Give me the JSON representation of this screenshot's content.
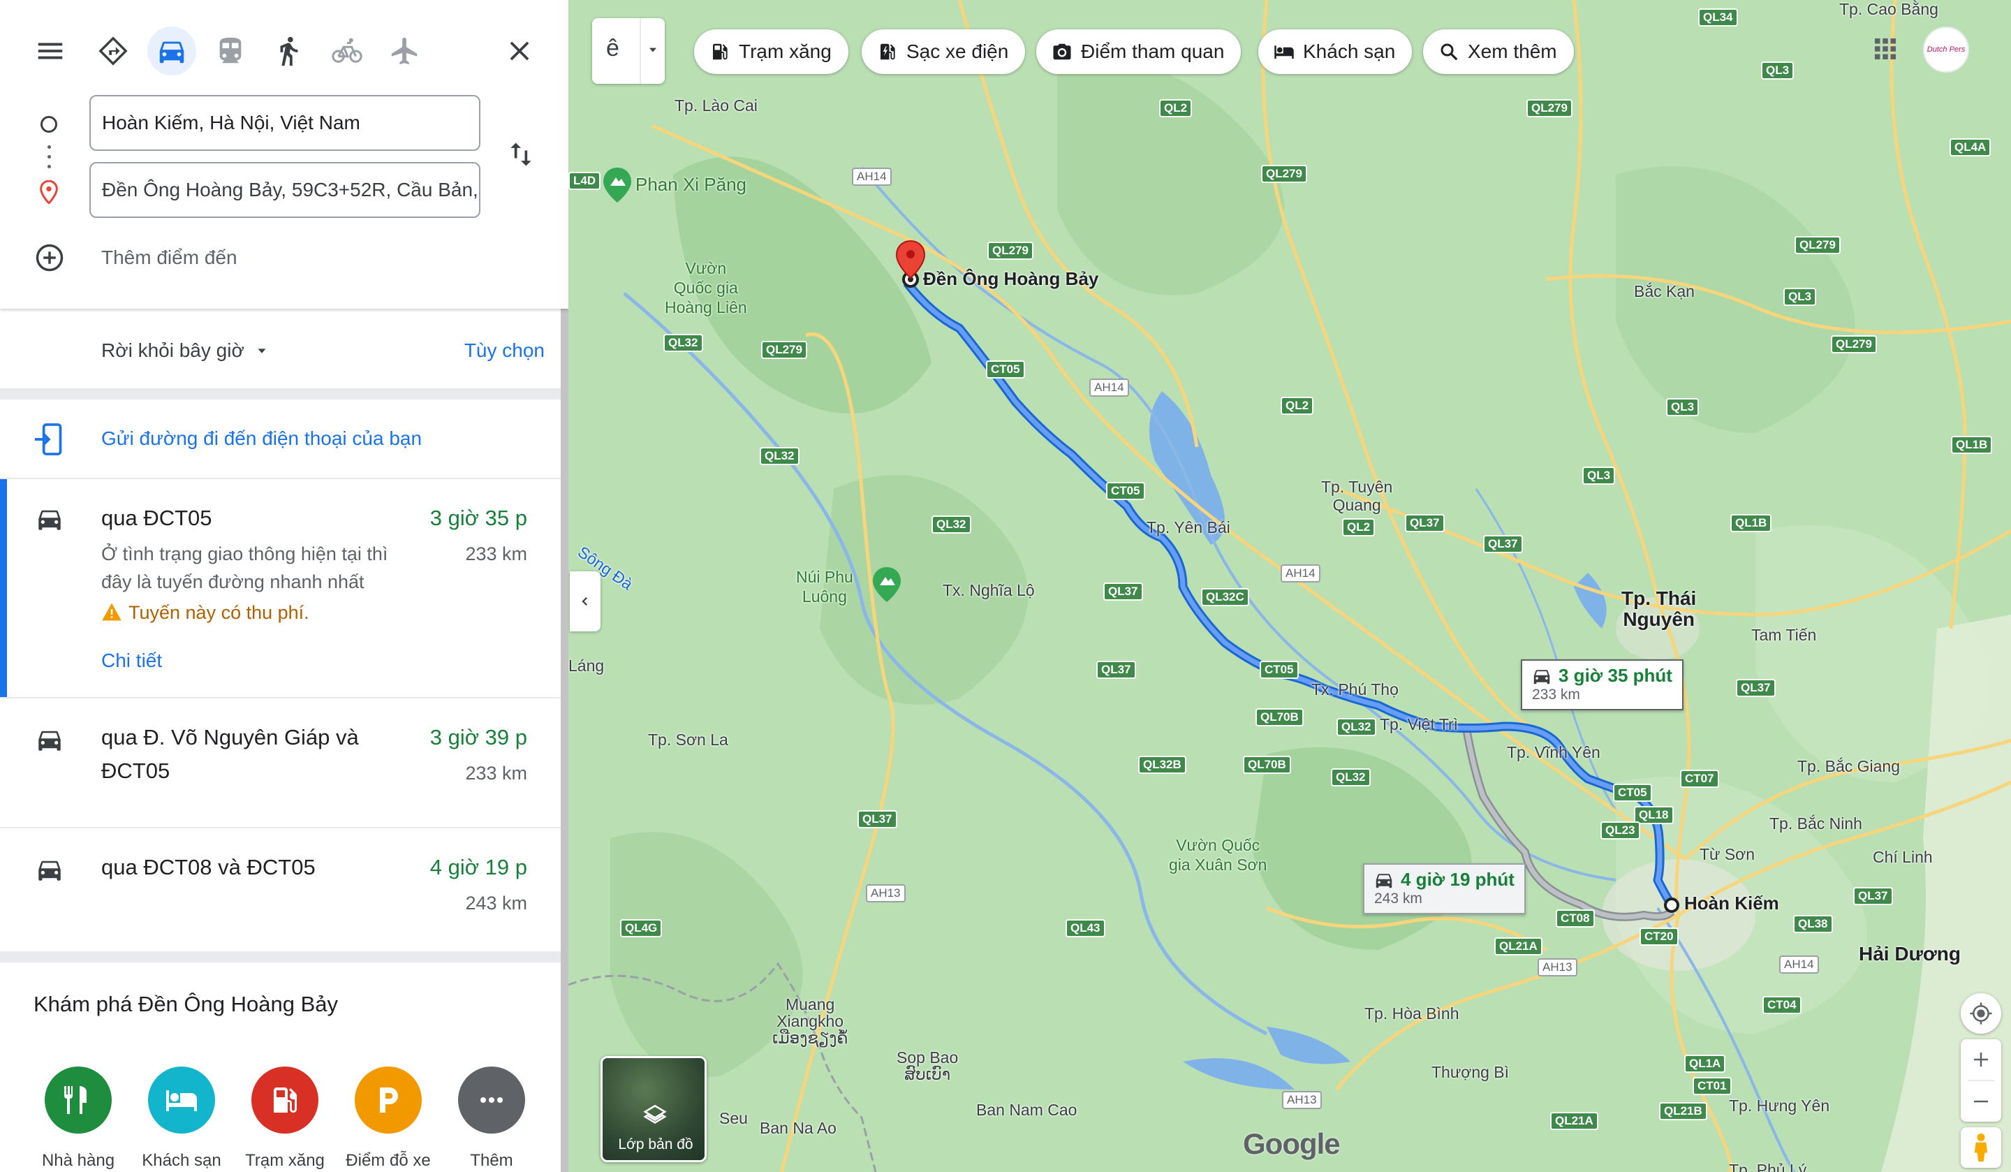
{
  "directions": {
    "origin_value": "Hoàn Kiếm, Hà Nội, Việt Nam",
    "destination_value": "Đền Ông Hoàng Bảy, 59C3+52R, Cầu Bản, ...",
    "add_destination": "Thêm điểm đến",
    "depart_label": "Rời khỏi bây giờ",
    "options_label": "Tùy chọn",
    "send_to_phone": "Gửi đường đi đến điện thoại của bạn"
  },
  "routes": [
    {
      "title": "qua ĐCT05",
      "time": "3 giờ 35 p",
      "distance": "233 km",
      "desc_line1": "Ở tình trạng giao thông hiện tại thì",
      "desc_line2": "đây là tuyến đường nhanh nhất",
      "warning": "Tuyến này có thu phí.",
      "details": "Chi tiết"
    },
    {
      "title_line1": "qua Đ. Võ Nguyên Giáp và",
      "title_line2": "ĐCT05",
      "time": "3 giờ 39 p",
      "distance": "233 km"
    },
    {
      "title": "qua ĐCT08 và ĐCT05",
      "time": "4 giờ 19 p",
      "distance": "243 km"
    }
  ],
  "explore": {
    "title": "Khám phá Đền Ông Hoàng Bảy",
    "categories": [
      {
        "label": "Nhà hàng",
        "icon": "restaurant-icon",
        "color": "#1e8e3e"
      },
      {
        "label": "Khách sạn",
        "icon": "hotel-icon",
        "color": "#12b5cb"
      },
      {
        "label": "Trạm xăng",
        "icon": "gas-station-icon",
        "color": "#d93025"
      },
      {
        "label": "Điểm đỗ xe",
        "icon": "parking-icon",
        "color": "#f29900"
      },
      {
        "label": "Thêm",
        "icon": "more-icon",
        "color": "#5f6368"
      }
    ]
  },
  "map": {
    "search_glyph": "ê",
    "chips": [
      "Trạm xăng",
      "Sạc xe điện",
      "Điểm tham quan",
      "Khách sạn",
      "Xem thêm"
    ],
    "avatar_text": "Dutch Pers",
    "layers_label": "Lớp bản đồ",
    "google_logo": "Google",
    "destination_label": "Đền Ông Hoàng Bảy",
    "origin_label": "Hoàn Kiếm",
    "route_primary": {
      "time": "3 giờ 35 phút",
      "distance": "233 km"
    },
    "route_alt": {
      "time": "4 giờ 19 phút",
      "distance": "243 km"
    },
    "places": {
      "lao_cai": "Tp. Lào Cai",
      "phan_xi_pang": "Phan Xi Păng",
      "hoang_lien": [
        "Vườn",
        "Quốc gia",
        "Hoàng Liên"
      ],
      "song_da": "Sông Đà",
      "nui_phu_luong": [
        "Núi Phu",
        "Luông"
      ],
      "nghia_lo": "Tx. Nghĩa Lộ",
      "yen_bai": "Tp. Yên Bái",
      "tuyen_quang": [
        "Tp. Tuyên",
        "Quang"
      ],
      "bac_kan": "Bắc Kạn",
      "thai_nguyen": [
        "Tp. Thái",
        "Nguyên"
      ],
      "tam_tien": "Tam Tiến",
      "phu_tho": "Tx. Phú Thọ",
      "viet_tri": "Tp. Việt Trì",
      "vinh_yen": "Tp. Vĩnh Yên",
      "bac_giang": "Tp. Bắc Giang",
      "bac_ninh": "Tp. Bắc Ninh",
      "tu_son": "Từ Sơn",
      "chi_linh": "Chí Linh",
      "hai_duong": "Hải Dương",
      "son_la": "Tp. Sơn La",
      "lang": "Láng",
      "xuan_son": [
        "Vườn Quốc",
        "gia Xuân Sơn"
      ],
      "hoa_binh": "Tp. Hòa Bình",
      "thuong_bi": "Thượng Bì",
      "hung_yen": "Tp. Hưng Yên",
      "muang": [
        "Muang",
        "Xiangkho",
        "ເມືອງຊຽງຄໍ້"
      ],
      "sop_bao": [
        "Sop Bao",
        "ສົບເບົາ"
      ],
      "ban_nam_cao": "Ban Nam Cao",
      "ban_na_ao": "Ban Na Ao",
      "seu": "Seu",
      "phu_ly": "Tp. Phủ Lý"
    },
    "roads": {
      "ct05a": "CT05",
      "ct05b": "CT05",
      "ct05c": "CT05",
      "ct05d": "CT05",
      "ct07": "CT07",
      "ct08": "CT08",
      "ct20": "CT20",
      "ct04": "CT04",
      "ct01": "CT01",
      "ql2a": "QL2",
      "ql2b": "QL2",
      "ql2c": "QL2",
      "ql279a": "QL279",
      "ql279b": "QL279",
      "ql279c": "QL279",
      "ql279d": "QL279",
      "ql279e": "QL279",
      "ql279f": "QL279",
      "ql32a": "QL32",
      "ql32b": "QL32",
      "ql32c": "QL32",
      "ql32d": "QL32",
      "ql32e": "QL32",
      "ql32c2": "QL32C",
      "ql32b2": "QL32B",
      "ql37a": "QL37",
      "ql37b": "QL37",
      "ql37c": "QL37",
      "ql37d": "QL37",
      "ql37e": "QL37",
      "ql37f": "QL37",
      "ql37g": "QL37",
      "ql3a": "QL3",
      "ql3b": "QL3",
      "ql3c": "QL3",
      "ql3d": "QL3",
      "ql1b": "QL1B",
      "ql1b2": "QL1B",
      "ql70b": "QL70B",
      "ql70b2": "QL70B",
      "ql18": "QL18",
      "ql23": "QL23",
      "ql21a": "QL21A",
      "ql21a2": "QL21A",
      "ql21b": "QL21B",
      "ql1a": "QL1A",
      "ql38": "QL38",
      "ql43": "QL43",
      "ql4g": "QL4G",
      "ql4a": "QL4A",
      "ql34": "QL34",
      "ql4d": "L4D",
      "ah14a": "AH14",
      "ah14b": "AH14",
      "ah14c": "AH14",
      "ah14d": "AH14",
      "ah13a": "AH13",
      "ah13b": "AH13",
      "ah13c": "AH13",
      "cao_bang": "Tp. Cao Bằng"
    }
  }
}
